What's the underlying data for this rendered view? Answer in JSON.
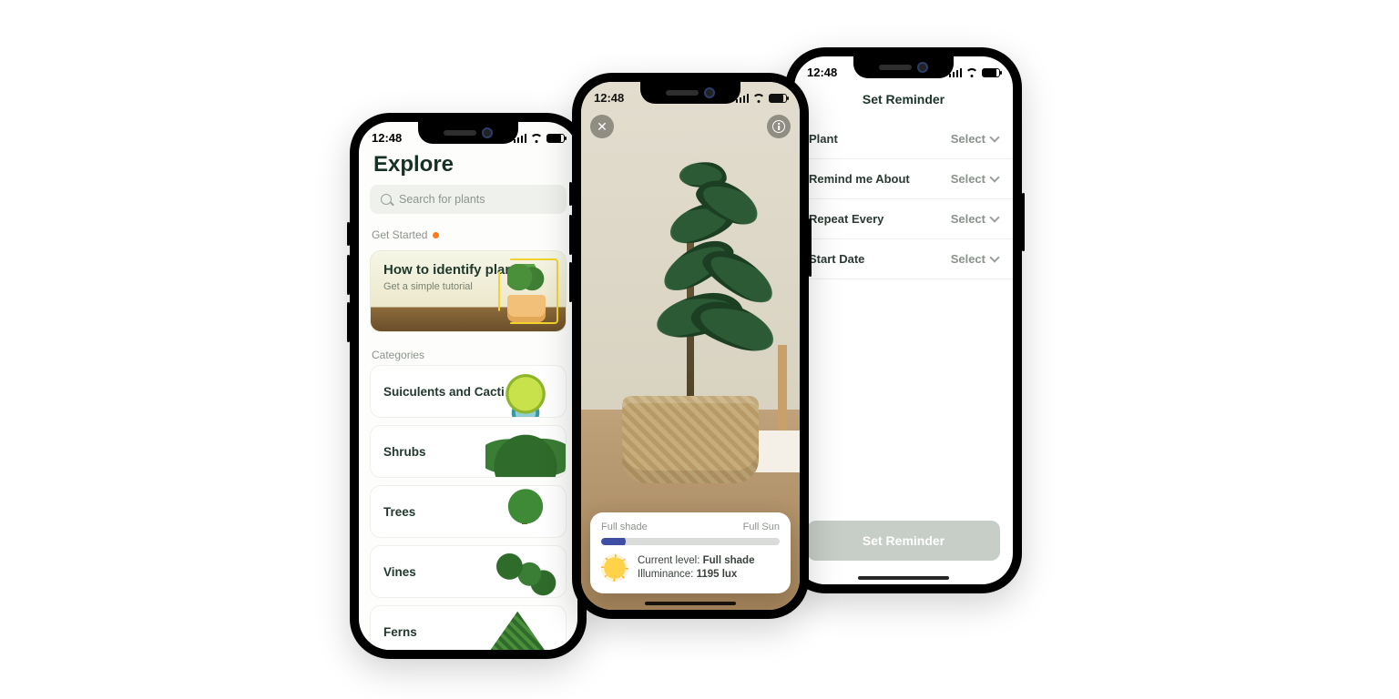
{
  "status_time": "12:48",
  "explore": {
    "title": "Explore",
    "search_placeholder": "Search for plants",
    "get_started_label": "Get Started",
    "card": {
      "title": "How to identify plants?",
      "subtitle": "Get a simple tutorial"
    },
    "categories_label": "Categories",
    "categories": [
      {
        "label": "Suiculents and Cacti"
      },
      {
        "label": "Shrubs"
      },
      {
        "label": "Trees"
      },
      {
        "label": "Vines"
      },
      {
        "label": "Ferns"
      }
    ]
  },
  "light_meter": {
    "left_label": "Full shade",
    "right_label": "Full Sun",
    "progress_pct": 10,
    "current_level_label": "Current level:",
    "current_level_value": "Full shade",
    "illuminance_label": "Illuminance: ",
    "illuminance_value": "1195 lux"
  },
  "reminder": {
    "header": "Set Reminder",
    "select_label": "Select",
    "rows": [
      {
        "label": "Plant"
      },
      {
        "label": "Remind me About"
      },
      {
        "label": "Repeat Every"
      },
      {
        "label": "Start Date"
      }
    ],
    "button": "Set Reminder"
  }
}
